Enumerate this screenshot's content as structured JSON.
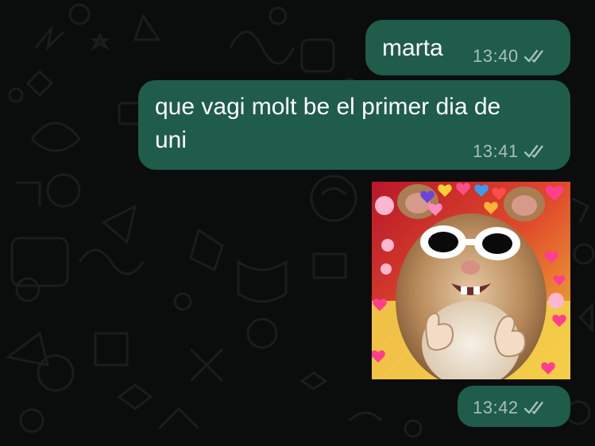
{
  "chat": {
    "messages": [
      {
        "text": "marta",
        "time": "13:40",
        "status": "read-double-check"
      },
      {
        "text_line1": "que vagi molt be el primer dia de",
        "text_line2": "uni",
        "time": "13:41",
        "status": "read-double-check"
      },
      {
        "type": "sticker",
        "sticker": "hamster-sunglasses-thumbs-up-hearts",
        "time": "13:42",
        "status": "read-double-check"
      }
    ]
  },
  "colors": {
    "background": "#0b0c0c",
    "bubble_outgoing": "#1f5c4a",
    "text": "#ffffff",
    "meta": "#a7c0b6"
  },
  "icons": [
    "double-check-icon"
  ]
}
